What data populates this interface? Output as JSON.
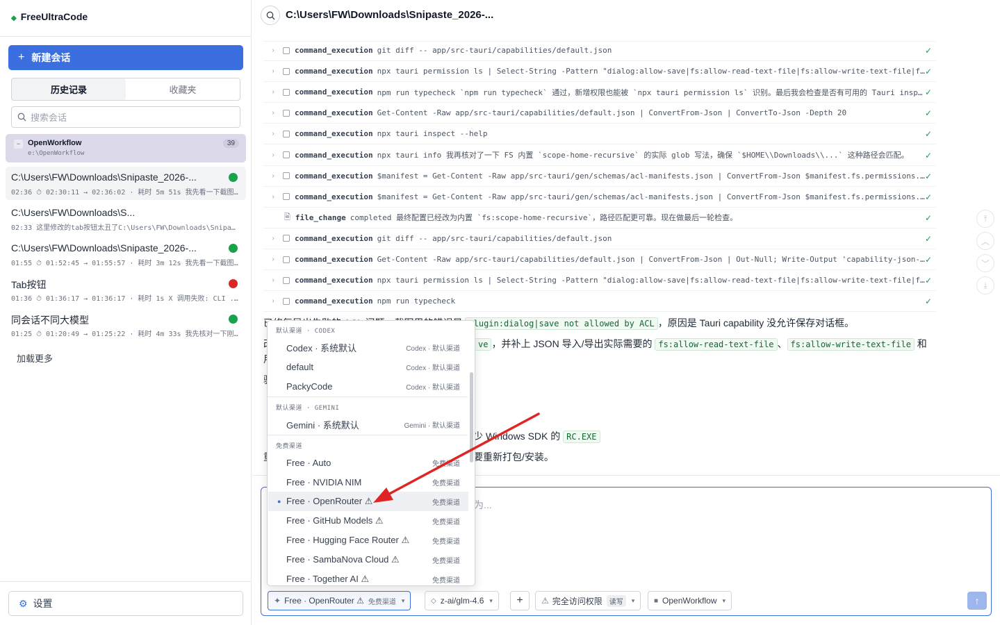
{
  "app": {
    "brand": "FreeUltraCode"
  },
  "sidebar": {
    "new_chat": "新建会话",
    "tabs": [
      {
        "label": "历史记录"
      },
      {
        "label": "收藏夹"
      }
    ],
    "search_placeholder": "搜索会话",
    "group": {
      "name": "OpenWorkflow",
      "path": "e:\\OpenWorkflow",
      "count": "39"
    },
    "sessions": [
      {
        "title": "C:\\Users\\FW\\Downloads\\Snipaste_2026-...",
        "meta": "02:36 ⏱ 02:30:11 → 02:36:02 · 耗时 5m 51s 我先看一下截图...",
        "status": "#16a34a",
        "active": true
      },
      {
        "title": "C:\\Users\\FW\\Downloads\\S...",
        "meta": "02:33 这里修改的tab按钮太丑了C:\\Users\\FW\\Downloads\\Snipas...",
        "status": "",
        "active": false
      },
      {
        "title": "C:\\Users\\FW\\Downloads\\Snipaste_2026-...",
        "meta": "01:55 ⏱ 01:52:45 → 01:55:57 · 耗时 3m 12s 我先看一下截图...",
        "status": "#16a34a",
        "active": false
      },
      {
        "title": "Tab按钮",
        "meta": "01:36 ⏱ 01:36:17 → 01:36:17 · 耗时 1s X 调用失败: CLI ...",
        "status": "#dc2626",
        "active": false
      },
      {
        "title": "同会话不同大模型",
        "meta": "01:25 ⏱ 01:20:49 → 01:25:22 · 耗时 4m 33s 我先核对一下刚...",
        "status": "#16a34a",
        "active": false
      }
    ],
    "load_more": "加载更多",
    "settings": "设置"
  },
  "main": {
    "title": "C:\\Users\\FW\\Downloads\\Snipaste_2026-...",
    "log_rows": [
      {
        "kw": "command_execution",
        "text": "git diff -- app/src-tauri/capabilities/default.json",
        "icon": "box"
      },
      {
        "kw": "command_execution",
        "text": "npx tauri permission ls | Select-String -Pattern \"dialog:allow-save|fs:allow-read-text-file|fs:allow-write-text-file|f...",
        "icon": "box"
      },
      {
        "kw": "command_execution",
        "text": "npm run typecheck `npm run typecheck` 通过，新增权限也能被 `npx tauri permission ls` 识别。最后我会检查是否有可用的 Tauri insp...",
        "icon": "box"
      },
      {
        "kw": "command_execution",
        "text": "Get-Content -Raw app/src-tauri/capabilities/default.json | ConvertFrom-Json | ConvertTo-Json -Depth 20",
        "icon": "box"
      },
      {
        "kw": "command_execution",
        "text": "npx tauri inspect --help",
        "icon": "box"
      },
      {
        "kw": "command_execution",
        "text": "npx tauri info 我再核对了一下 FS 内置 `scope-home-recursive` 的实际 glob 写法，确保 `$HOME\\\\Downloads\\\\...` 这种路径会匹配。",
        "icon": "box"
      },
      {
        "kw": "command_execution",
        "text": "$manifest = Get-Content -Raw app/src-tauri/gen/schemas/acl-manifests.json | ConvertFrom-Json $manifest.fs.permissions...",
        "icon": "box"
      },
      {
        "kw": "command_execution",
        "text": "$manifest = Get-Content -Raw app/src-tauri/gen/schemas/acl-manifests.json | ConvertFrom-Json $manifest.fs.permissions...",
        "icon": "box"
      },
      {
        "kw": "file_change",
        "text": "completed 最终配置已经改为内置 `fs:scope-home-recursive`，路径匹配更可靠。现在做最后一轮检查。",
        "icon": "file"
      },
      {
        "kw": "command_execution",
        "text": "git diff -- app/src-tauri/capabilities/default.json",
        "icon": "box"
      },
      {
        "kw": "command_execution",
        "text": "Get-Content -Raw app/src-tauri/capabilities/default.json | ConvertFrom-Json | Out-Null; Write-Output 'capability-json-...",
        "icon": "box"
      },
      {
        "kw": "command_execution",
        "text": "npx tauri permission ls | Select-String -Pattern \"dialog:allow-save|fs:allow-read-text-file|fs:allow-write-text-file|f...",
        "icon": "box"
      },
      {
        "kw": "command_execution",
        "text": "npm run typecheck",
        "icon": "box"
      }
    ],
    "prose": {
      "l1_pre": "已修复导出失败的 ACL 问题。截图里的错误是 ",
      "l1_code": "plugin:dialog|save not allowed by ACL",
      "l1_post": "，原因是 Tauri capability 没允许保存对话框。",
      "l2_pre": "改",
      "l2_code1": "ve",
      "l2_mid": "，并补上 JSON 导入/导出实际需要的 ",
      "l2_code2": "fs:allow-read-text-file",
      "l2_sep": "、",
      "l2_code3": "fs:allow-write-text-file",
      "l2_post": " 和",
      "l3": "用",
      "l4": "验",
      "l5_pre": "少 Windows SDK 的 ",
      "l5_code": "RC.EXE",
      "l6_pre": "重",
      "l6_post": "要重新打包/安装。"
    },
    "composer": {
      "placeholder": "为...",
      "model_chip": "Free · OpenRouter ⚠",
      "model_chip_tag": "免费渠道",
      "model2": "z-ai/glm-4.6",
      "add": "+",
      "perm": "完全访问权限",
      "perm_badge": "读写",
      "project": "OpenWorkflow"
    }
  },
  "dropdown": {
    "sections": [
      {
        "header": "默认渠道 · CODEX",
        "items": [
          {
            "label": "Codex · 系统默认",
            "tag": "Codex · 默认渠道"
          },
          {
            "label": "default",
            "tag": "Codex · 默认渠道"
          },
          {
            "label": "PackyCode",
            "tag": "Codex · 默认渠道"
          }
        ]
      },
      {
        "header": "默认渠道 · GEMINI",
        "items": [
          {
            "label": "Gemini · 系统默认",
            "tag": "Gemini · 默认渠道"
          }
        ]
      },
      {
        "header": "免费渠道",
        "items": [
          {
            "label": "Free · Auto",
            "tag": "免费渠道"
          },
          {
            "label": "Free · NVIDIA NIM",
            "tag": "免费渠道"
          },
          {
            "label": "Free · OpenRouter ⚠",
            "tag": "免费渠道",
            "selected": true
          },
          {
            "label": "Free · GitHub Models ⚠",
            "tag": "免费渠道"
          },
          {
            "label": "Free · Hugging Face Router ⚠",
            "tag": "免费渠道"
          },
          {
            "label": "Free · SambaNova Cloud ⚠",
            "tag": "免费渠道"
          },
          {
            "label": "Free · Together AI ⚠",
            "tag": "免费渠道"
          }
        ]
      }
    ]
  },
  "colors": {
    "accent": "#3b6fe0",
    "success": "#16a34a",
    "error": "#dc2626",
    "annotation_arrow": "#e02424"
  }
}
